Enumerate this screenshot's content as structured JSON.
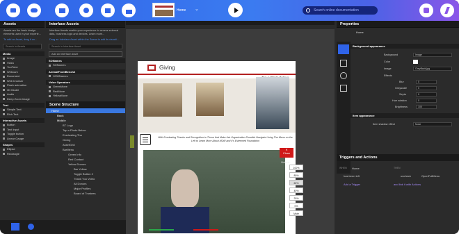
{
  "topbar": {
    "page_name": "Home",
    "search_placeholder": "Search online documentation"
  },
  "assets": {
    "title": "Assets",
    "description": "Assets are the basic design elements used in your experie...",
    "tip": "To add an Asset, drag it on...",
    "search_placeholder": "Search in Assets",
    "sections": [
      {
        "name": "Media",
        "items": [
          "Image",
          "Video",
          "YouTube",
          "Webcam",
          "Document",
          "Web browser",
          "Flash animation",
          "3D Model",
          "Audio",
          "Deep Zoom image"
        ]
      },
      {
        "name": "Text",
        "items": [
          "Simple Text",
          "Rich Text"
        ]
      },
      {
        "name": "Interactive Assets",
        "items": [
          "Button",
          "Text Input",
          "Toggle button",
          "Linear Gauge"
        ]
      },
      {
        "name": "Shapes",
        "items": [
          "Ellipse",
          "Rectangle"
        ]
      }
    ]
  },
  "interface_assets": {
    "title": "Interface Assets",
    "description": "Interface Assets enable your experience to access external data, business logic and devices. Learn more...",
    "tip": "Drag an Interface Asset within the Scene to add its visuali...",
    "search_placeholder": "Search in Interface Asset",
    "add_button": "Add an Interface Asset",
    "groups": [
      {
        "name": "SONames",
        "items": [
          "SONames"
        ]
      },
      {
        "name": "AnimatFrontBench2",
        "items": [
          "1000Names"
        ]
      },
      {
        "name": "Value Operators",
        "items": [
          "GreenMove",
          "RedMove",
          "YellowMove"
        ]
      }
    ]
  },
  "scene_structure": {
    "title": "Scene Structure",
    "rows": [
      "Home",
      "Back",
      "Middle",
      "BT Logo",
      "Tap a Photo Below",
      "Everlasting Tha",
      "Giving",
      "AssetGrid",
      "BarMenu",
      "Green Info",
      "Red Contact",
      "Yellow Donors",
      "Bar Yellow",
      "Toggle Button 2",
      "Thank You Video",
      "All Donors",
      "Major Profiles",
      "Board of Trustees"
    ]
  },
  "slide": {
    "title": "Giving",
    "tap_text": "Tap a Photo Below:",
    "body_text": "With Everlasting Thanks and Recognition to Those that Make this Organization Possible Navigate Using The Menu on the Left to Learn More About MOM and It's Esteemed Foundation",
    "volume_label": "Volume:",
    "volume_options": [
      "100%",
      "80%",
      "60%",
      "40%",
      "20%",
      "0%",
      "Mute"
    ],
    "close_label": "Close"
  },
  "properties": {
    "title": "Properties",
    "page": "Home",
    "background_section": "Background appearance",
    "rows": [
      {
        "label": "Background",
        "value": "Image"
      },
      {
        "label": "Color",
        "value": ""
      },
      {
        "label": "Image",
        "value": "GreyBack.jpg"
      },
      {
        "label": "Effects",
        "value": ""
      },
      {
        "label": "Blur",
        "value": "0"
      },
      {
        "label": "Grayscale",
        "value": "0"
      },
      {
        "label": "Sepia",
        "value": "0"
      },
      {
        "label": "Hue rotation",
        "value": "0"
      },
      {
        "label": "Brightness",
        "value": "100"
      }
    ],
    "item_section": "Item appearance",
    "item_rows": [
      {
        "label": "Item shadow effect",
        "value": "None"
      }
    ]
  },
  "triggers": {
    "title": "Triggers and Actions",
    "when_label": "WHEN",
    "then_label": "THEN",
    "trigger_item": "Home",
    "trigger_condition": "has been left",
    "action_item": "uncheck",
    "action_target": "OpenFullMenu",
    "add_trigger": "Add a Trigger",
    "add_action": "and link it with Actions"
  }
}
